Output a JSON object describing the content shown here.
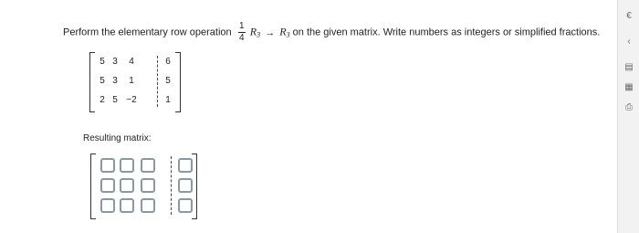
{
  "question": {
    "before": "Perform the elementary row operation",
    "fraction_num": "1",
    "fraction_den": "4",
    "row_from": "R",
    "row_from_sub": "3",
    "arrow": "→",
    "row_to": "R",
    "row_to_sub": "3",
    "after": "on the given matrix. Write numbers as integers or simplified fractions."
  },
  "given_matrix": {
    "rows": [
      [
        "5",
        "3",
        "4",
        "6"
      ],
      [
        "5",
        "3",
        "1",
        "5"
      ],
      [
        "2",
        "5",
        "−2",
        "1"
      ]
    ]
  },
  "result_label": "Resulting matrix:",
  "answer_rows": 3,
  "answer_cols": 4,
  "side_icons": [
    "euro-icon",
    "chevron-left-icon",
    "calculator-icon",
    "table-icon",
    "printer-icon"
  ],
  "side_icon_glyphs": [
    "€",
    "‹",
    "▤",
    "▦",
    "⎙"
  ]
}
